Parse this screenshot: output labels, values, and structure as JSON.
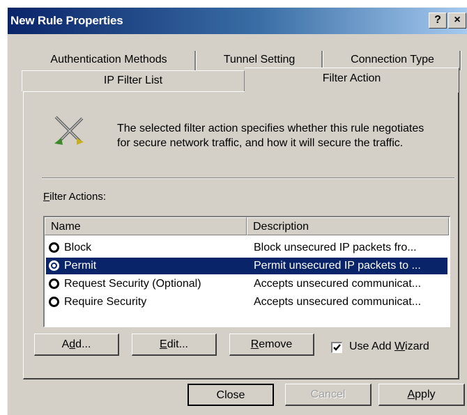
{
  "window": {
    "title": "New Rule Properties",
    "help_button": "?",
    "close_button": "×"
  },
  "tabs": {
    "back_row": [
      "Authentication Methods",
      "Tunnel Setting",
      "Connection Type"
    ],
    "front_row": [
      "IP Filter List",
      "Filter Action"
    ],
    "active": "Filter Action"
  },
  "intro": {
    "icon": "filter-action-icon",
    "line1": "The selected filter action specifies whether this rule negotiates",
    "line2": "for secure network traffic, and how it will secure the traffic."
  },
  "filter_actions": {
    "label_prefix": "",
    "label_accel": "F",
    "label_rest": "ilter Actions:",
    "columns": [
      "Name",
      "Description"
    ],
    "rows": [
      {
        "name": "Block",
        "description": "Block unsecured IP packets fro...",
        "selected": false
      },
      {
        "name": "Permit",
        "description": "Permit unsecured IP packets to ...",
        "selected": true
      },
      {
        "name": "Request Security (Optional)",
        "description": "Accepts unsecured communicat...",
        "selected": false
      },
      {
        "name": "Require Security",
        "description": "Accepts unsecured communicat...",
        "selected": false
      }
    ]
  },
  "buttons": {
    "add": {
      "pre": "A",
      "accel": "d",
      "post": "d..."
    },
    "edit": {
      "pre": "",
      "accel": "E",
      "post": "dit..."
    },
    "remove": {
      "pre": "",
      "accel": "R",
      "post": "emove"
    },
    "use_wizard": {
      "pre": "Use Add ",
      "accel": "W",
      "post": "izard",
      "checked": true
    }
  },
  "footer": {
    "close": "Close",
    "cancel": "Cancel",
    "apply_accel": "A",
    "apply_rest": "pply"
  },
  "colors": {
    "title_start": "#0a246a",
    "title_end": "#a6caf0",
    "face": "#d4d0c8",
    "selection": "#0a246a"
  }
}
